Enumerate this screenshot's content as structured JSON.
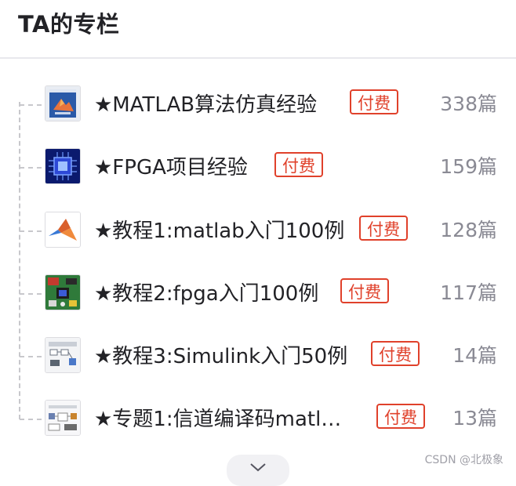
{
  "section": {
    "title": "TA的专栏"
  },
  "columns": [
    {
      "name": "★MATLAB算法仿真经验",
      "badge": "付费",
      "count": "338篇",
      "icon": "matlab-book-cover-icon"
    },
    {
      "name": "★FPGA项目经验",
      "badge": "付费",
      "count": "159篇",
      "icon": "fpga-chip-icon"
    },
    {
      "name": "★教程1:matlab入门100例",
      "badge": "付费",
      "count": "128篇",
      "icon": "matlab-logo-icon"
    },
    {
      "name": "★教程2:fpga入门100例",
      "badge": "付费",
      "count": "117篇",
      "icon": "fpga-board-icon"
    },
    {
      "name": "★教程3:Simulink入门50例",
      "badge": "付费",
      "count": "14篇",
      "icon": "simulink-model-icon"
    },
    {
      "name": "★专题1:信道编译码matl…",
      "badge": "付费",
      "count": "13篇",
      "icon": "channel-coding-diagram-icon"
    }
  ],
  "expand_icon": "chevron-down-icon",
  "watermark": "CSDN @北极象",
  "colors": {
    "badge": "#e0412b",
    "count": "#8a8a94",
    "divider": "#e8e8ed",
    "tree_line": "#c8c8cc"
  }
}
